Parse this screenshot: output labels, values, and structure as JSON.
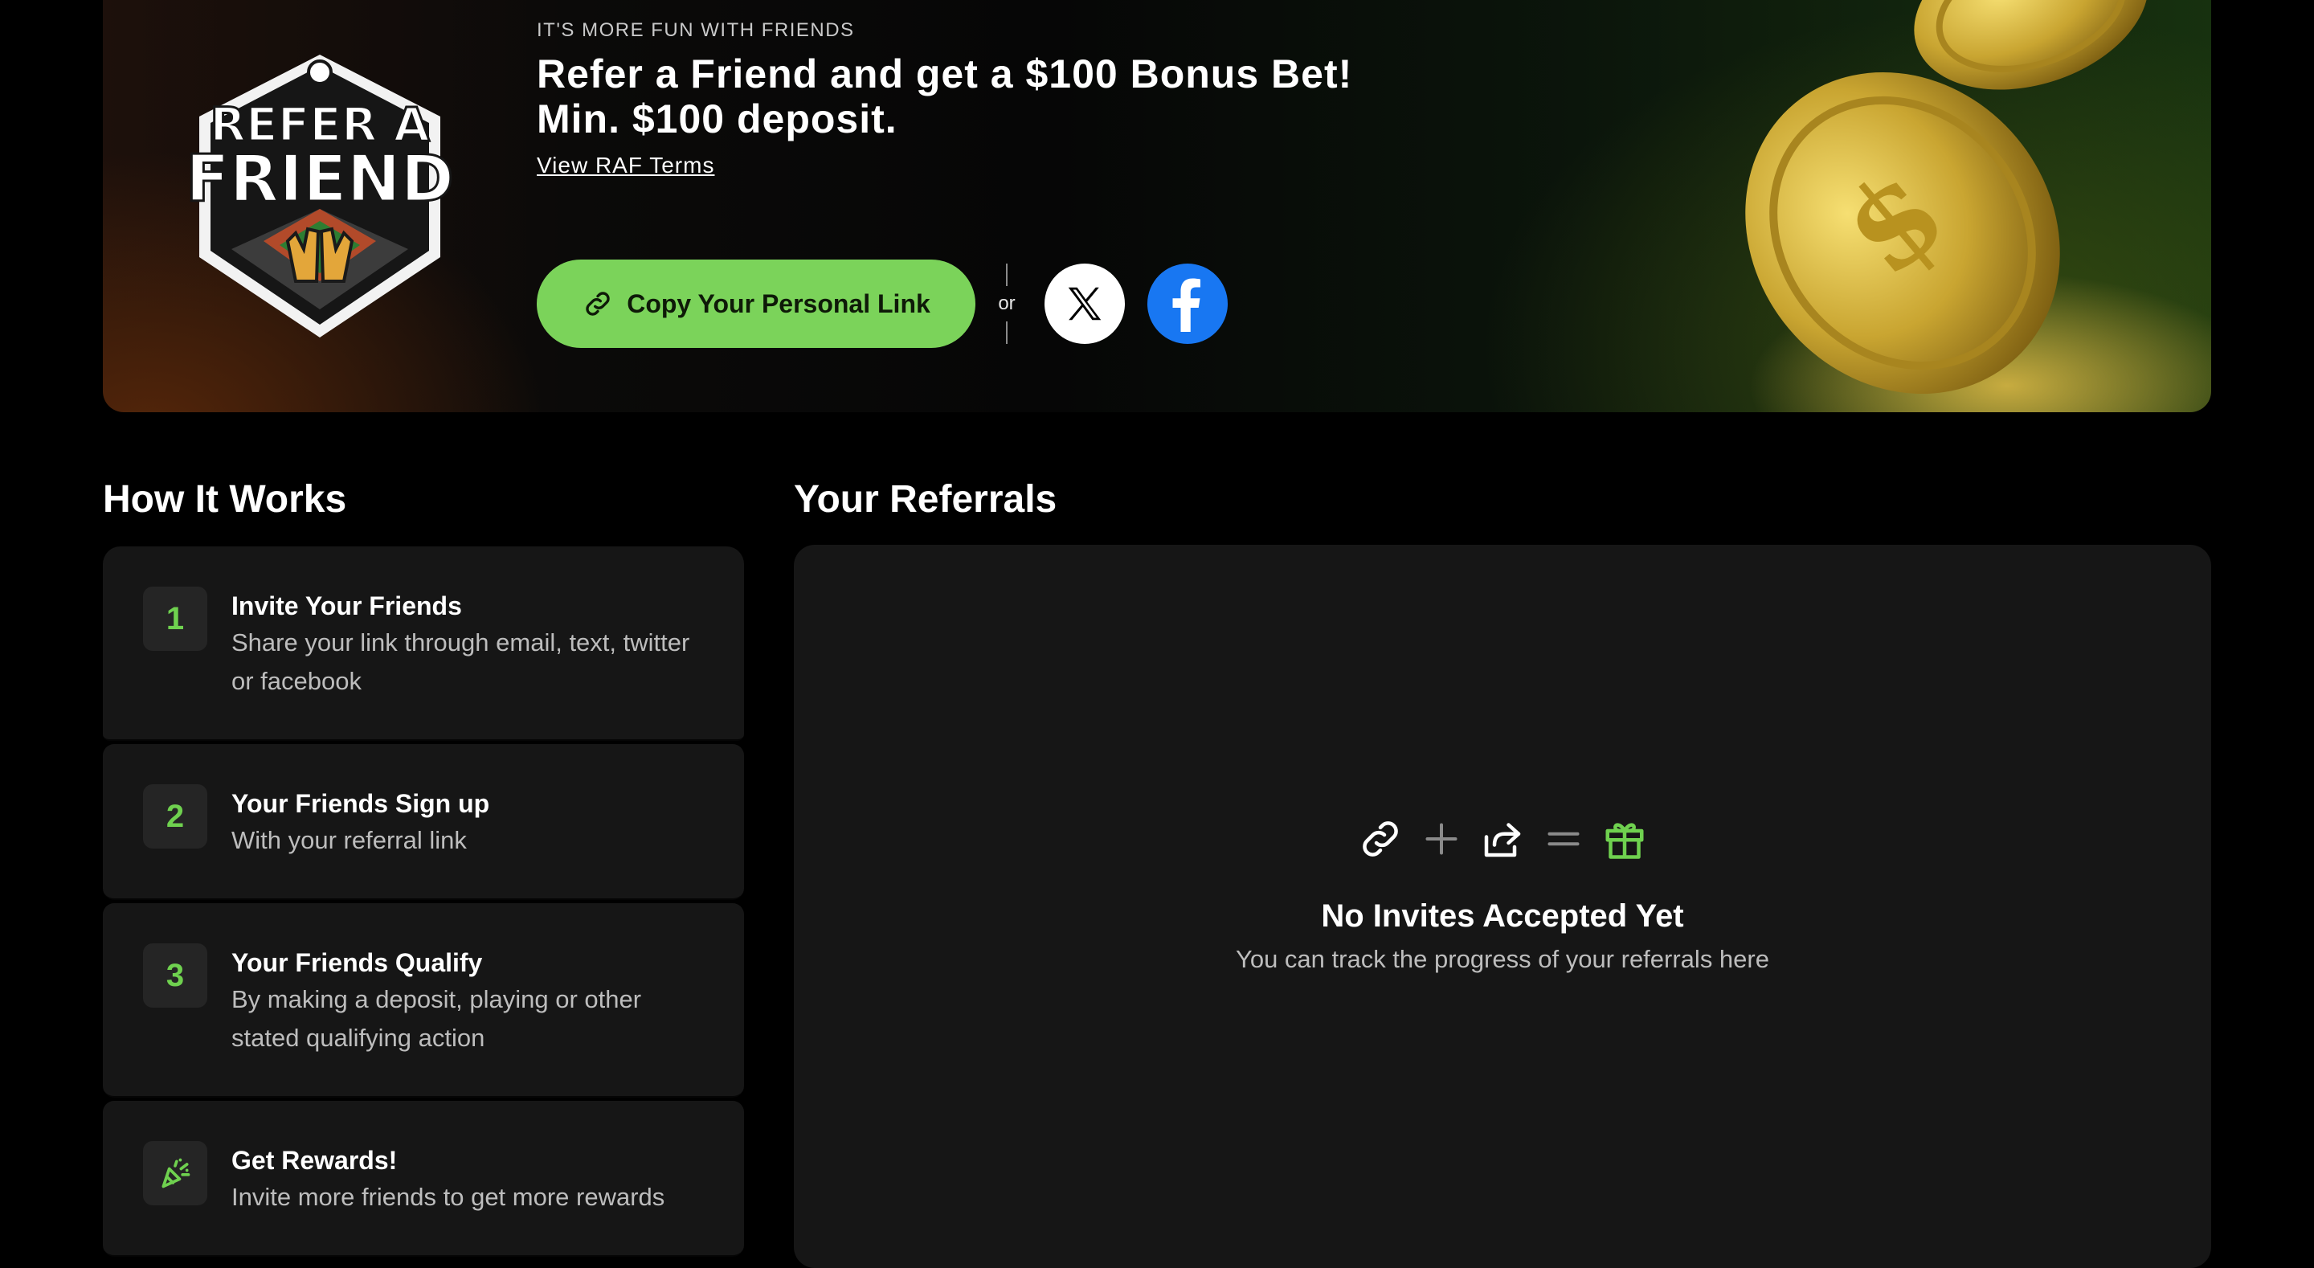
{
  "colors": {
    "accent_green": "#7bd35a",
    "step_number_green": "#6fd14f",
    "facebook_blue": "#1877f2",
    "panel_bg": "#161616"
  },
  "hero": {
    "logo_text_top": "REFER A",
    "logo_text_bottom": "FRIEND",
    "eyebrow": "IT'S MORE FUN WITH FRIENDS",
    "headline_line1": "Refer a Friend and get a $100 Bonus Bet!",
    "headline_line2": "Min. $100 deposit.",
    "terms_link": "View RAF Terms",
    "copy_button": "Copy Your Personal Link",
    "or_text": "or",
    "share_x_icon": "x-logo-icon",
    "share_facebook_icon": "facebook-logo-icon"
  },
  "how_it_works": {
    "title": "How It Works",
    "steps": [
      {
        "number": "1",
        "title": "Invite Your Friends",
        "description": "Share your link through email, text, twitter or facebook"
      },
      {
        "number": "2",
        "title": "Your Friends Sign up",
        "description": "With your referral link"
      },
      {
        "number": "3",
        "title": "Your Friends Qualify",
        "description": "By making a deposit, playing or other stated qualifying action"
      },
      {
        "icon": "party-popper-icon",
        "title": "Get Rewards!",
        "description": "Invite more friends to get more rewards"
      }
    ]
  },
  "referrals": {
    "title": "Your Referrals",
    "empty_icons": [
      "link-icon",
      "plus-icon",
      "share-icon",
      "equals-icon",
      "gift-icon"
    ],
    "empty_title": "No Invites Accepted Yet",
    "empty_description": "You can track the progress of your referrals here"
  }
}
